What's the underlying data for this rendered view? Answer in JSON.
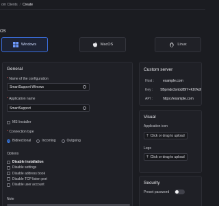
{
  "breadcrumb": {
    "parent": "om Clients",
    "separator": "/",
    "current": "Create"
  },
  "os": {
    "title": "OS",
    "tabs": [
      {
        "label": "Windows",
        "icon": "windows-icon",
        "active": true
      },
      {
        "label": "MacOS",
        "icon": "apple-icon",
        "active": false
      },
      {
        "label": "Linux",
        "icon": "linux-icon",
        "active": false
      }
    ]
  },
  "general": {
    "title": "General",
    "config_name_label": "Name of the configuration",
    "config_name_value": "SmartSupport-Winows",
    "app_name_label": "Application name",
    "app_name_value": "SmartSupport",
    "msi_installer_label": "MSI installer",
    "connection_type_label": "Connection type",
    "connection_options": [
      {
        "label": "Bidirectional",
        "selected": true
      },
      {
        "label": "Incoming",
        "selected": false
      },
      {
        "label": "Outgoing",
        "selected": false
      }
    ],
    "options_label": "Options",
    "options": [
      {
        "label": "Disable installation",
        "bold": true
      },
      {
        "label": "Disable settings",
        "bold": false
      },
      {
        "label": "Disable address book",
        "bold": false
      },
      {
        "label": "Disable TCP listen port",
        "bold": false
      },
      {
        "label": "Disable user account",
        "bold": false
      }
    ],
    "note_label": "Note"
  },
  "custom_server": {
    "title": "Custom server",
    "host_label": "Host :",
    "host_value": "example.com",
    "key_label": "Key :",
    "key_value": "5Bpmdn3xnbi2BlY+K87kdlwRlf",
    "api_label": "API :",
    "api_value": "https://example.com"
  },
  "visual": {
    "title": "Visual",
    "app_icon_label": "Application icon",
    "app_icon_button": "Click or drag to upload",
    "logo_label": "Logo",
    "logo_button": "Click or drag to upload"
  },
  "security": {
    "title": "Security",
    "preset_password_label": "Preset password",
    "preset_password_on": false
  },
  "colors": {
    "accent": "#3b82f6",
    "required": "#e05a5a"
  }
}
